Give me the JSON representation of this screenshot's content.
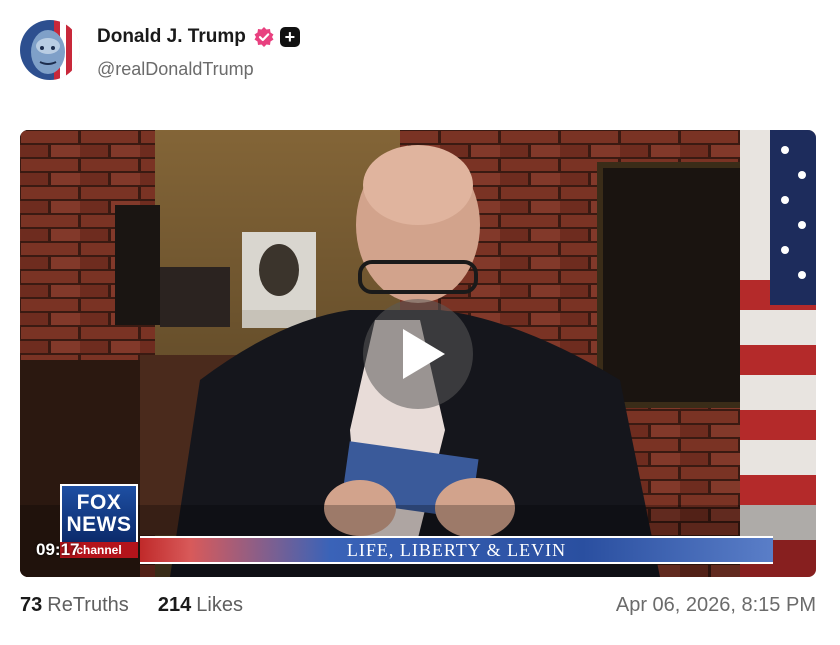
{
  "author": {
    "display_name": "Donald J. Trump",
    "handle": "@realDonaldTrump",
    "verified_icon": "verified-badge-icon",
    "plus_icon": "plus-badge-icon"
  },
  "video": {
    "timestamp": "09:17",
    "network_logo_line1": "FOX",
    "network_logo_line2": "NEWS",
    "network_logo_sub": "channel",
    "lower_third": "LIFE, LIBERTY & LEVIN",
    "play_icon": "play-icon"
  },
  "stats": {
    "retruths_count": "73",
    "retruths_label": "ReTruths",
    "likes_count": "214",
    "likes_label": "Likes",
    "date": "Apr 06, 2026, 8:15 PM"
  },
  "colors": {
    "verified": "#e8407f",
    "plus_badge": "#111111",
    "muted_text": "#6b6b6b"
  }
}
